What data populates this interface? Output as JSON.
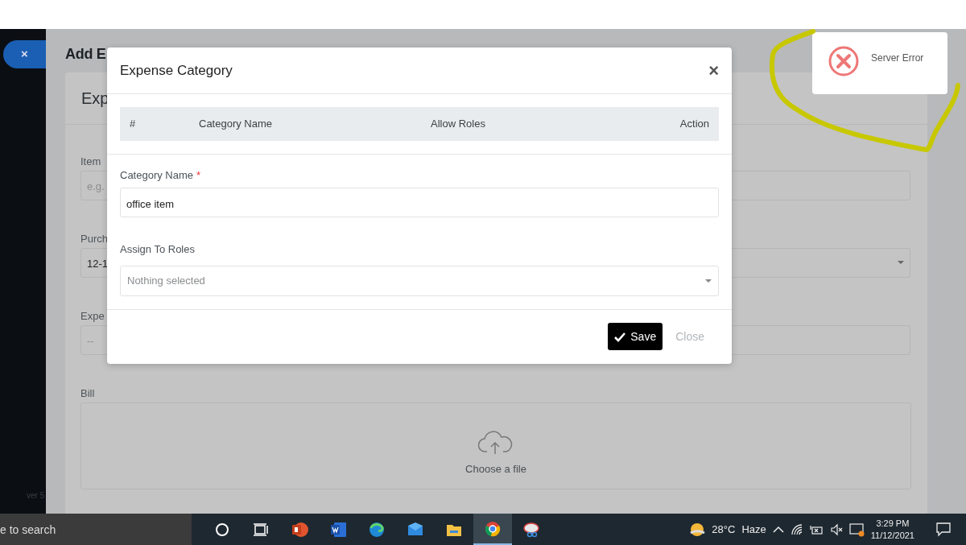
{
  "sidebar": {
    "close_button": "×",
    "version": "ver 5"
  },
  "page": {
    "title": "Add E",
    "card_title": "Exp",
    "rows": [
      {
        "label": "Item",
        "left": {
          "kind": "input",
          "placeholder": "e.g."
        },
        "right": {
          "kind": "input"
        }
      },
      {
        "label": "Purch",
        "left": {
          "kind": "input",
          "value": "12-1"
        },
        "right": {
          "kind": "select"
        }
      },
      {
        "label": "Expe",
        "left": {
          "kind": "addon",
          "placeholder": "--"
        },
        "right": {
          "kind": "input"
        }
      }
    ],
    "bill": {
      "label": "Bill",
      "text": "Choose a file"
    }
  },
  "modal": {
    "title": "Expense Category",
    "close": "×",
    "columns": [
      "#",
      "Category Name",
      "Allow Roles",
      "Action"
    ],
    "category": {
      "label": "Category Name",
      "required": "*",
      "value": "office item"
    },
    "roles": {
      "label": "Assign To Roles",
      "placeholder": "Nothing selected"
    },
    "buttons": [
      {
        "kind": "primary",
        "label": "Save"
      },
      {
        "kind": "link",
        "label": "Close"
      }
    ]
  },
  "toast": {
    "message": "Server Error"
  },
  "taskbar": {
    "search": "e to search",
    "apps": [
      {
        "kind": "cortana",
        "selected": false
      },
      {
        "kind": "taskview",
        "selected": false
      },
      {
        "kind": "powerpoint",
        "selected": false
      },
      {
        "kind": "word",
        "selected": false
      },
      {
        "kind": "edge",
        "selected": false
      },
      {
        "kind": "mail",
        "selected": false
      },
      {
        "kind": "explorer",
        "selected": false
      },
      {
        "kind": "chrome",
        "selected": true
      },
      {
        "kind": "snip",
        "selected": false
      }
    ],
    "weather": {
      "temp": "28°C",
      "condition": "Haze"
    },
    "time": "3:29 PM",
    "date": "11/12/2021"
  }
}
